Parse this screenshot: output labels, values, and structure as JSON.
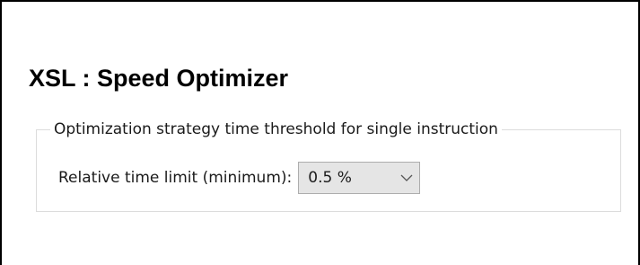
{
  "header": {
    "title": "XSL : Speed Optimizer"
  },
  "group": {
    "legend": "Optimization strategy time threshold for single instruction",
    "relative_time_limit": {
      "label": "Relative time limit (minimum):",
      "selected_value": "0.5 %"
    }
  },
  "icons": {
    "dropdown": "chevron-down-icon"
  }
}
